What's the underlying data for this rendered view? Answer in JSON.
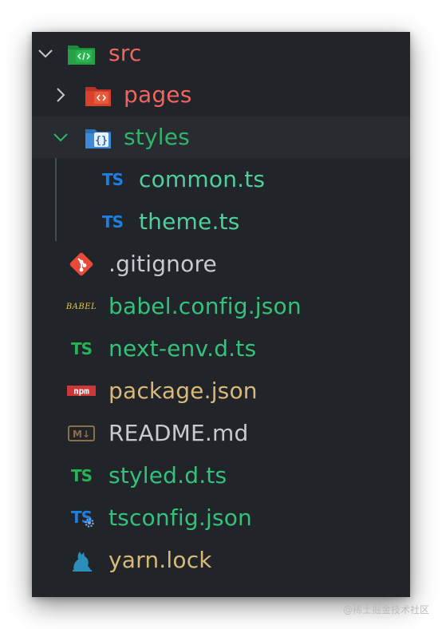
{
  "tree": {
    "src": {
      "label": "src",
      "icon": "folder-source-icon",
      "expanded": true
    },
    "pages": {
      "label": "pages",
      "icon": "folder-pages-icon",
      "expanded": false
    },
    "styles": {
      "label": "styles",
      "icon": "folder-styles-icon",
      "expanded": true,
      "selected": true
    },
    "common_ts": {
      "label": "common.ts",
      "icon_text": "TS"
    },
    "theme_ts": {
      "label": "theme.ts",
      "icon_text": "TS"
    },
    "gitignore": {
      "label": ".gitignore",
      "icon": "git-icon"
    },
    "babel_config": {
      "label": "babel.config.json",
      "icon_text": "BABEL"
    },
    "next_env": {
      "label": "next-env.d.ts",
      "icon_text": "TS"
    },
    "package_json": {
      "label": "package.json",
      "icon_text": "npm"
    },
    "readme": {
      "label": "README.md",
      "icon_text": "M↓"
    },
    "styled_dts": {
      "label": "styled.d.ts",
      "icon_text": "TS"
    },
    "tsconfig": {
      "label": "tsconfig.json",
      "icon_text": "TS"
    },
    "yarn_lock": {
      "label": "yarn.lock",
      "icon": "yarn-cat-icon"
    }
  },
  "watermark": "@稀土掘金技术社区",
  "colors": {
    "panel_bg": "#212429",
    "selected_bg": "#282c31",
    "folder_red_text": "#ef6560",
    "folder_green_text": "#2fb56a",
    "file_teal_text": "#4fcf9a"
  }
}
